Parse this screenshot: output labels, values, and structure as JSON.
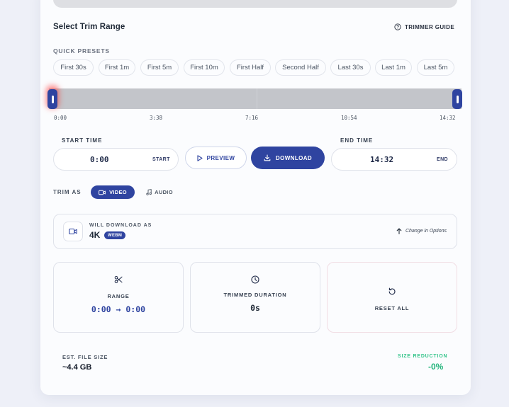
{
  "trim": {
    "title": "Select Trim Range",
    "guide_label": "TRIMMER GUIDE",
    "presets_label": "QUICK PRESETS",
    "presets": [
      "First 30s",
      "First 1m",
      "First 5m",
      "First 10m",
      "First Half",
      "Second Half",
      "Last 30s",
      "Last 1m",
      "Last 5m"
    ],
    "ticks": [
      "0:00",
      "3:38",
      "7:16",
      "10:54",
      "14:32"
    ],
    "start_label": "START TIME",
    "start_value": "0:00",
    "start_tag": "START",
    "end_label": "END TIME",
    "end_value": "14:32",
    "end_tag": "END",
    "preview_label": "PREVIEW",
    "download_label": "DOWNLOAD"
  },
  "trim_as": {
    "label": "TRIM AS",
    "video_label": "VIDEO",
    "audio_label": "AUDIO",
    "selected": "VIDEO"
  },
  "download_info": {
    "label": "WILL DOWNLOAD AS",
    "resolution": "4K",
    "format": "WEBM",
    "change_label": "Change in Options"
  },
  "stats": {
    "range_label": "RANGE",
    "range_value": "0:00 → 0:00",
    "duration_label": "TRIMMED DURATION",
    "duration_value": "0s",
    "reset_label": "RESET ALL"
  },
  "summary": {
    "est_label": "EST. FILE SIZE",
    "est_value": "~4.4 GB",
    "reduction_label": "SIZE REDUCTION",
    "reduction_value": "-0%"
  },
  "colors": {
    "accent": "#2f44a0",
    "success": "#22b47b",
    "timeline": "#c3c5ca"
  },
  "icons": {
    "guide": "help-circle-icon",
    "preview": "play-icon",
    "download": "download-icon",
    "video": "video-camera-icon",
    "audio": "music-note-icon",
    "change": "arrow-up-icon",
    "range": "scissors-icon",
    "duration": "clock-icon",
    "reset": "reset-icon"
  }
}
